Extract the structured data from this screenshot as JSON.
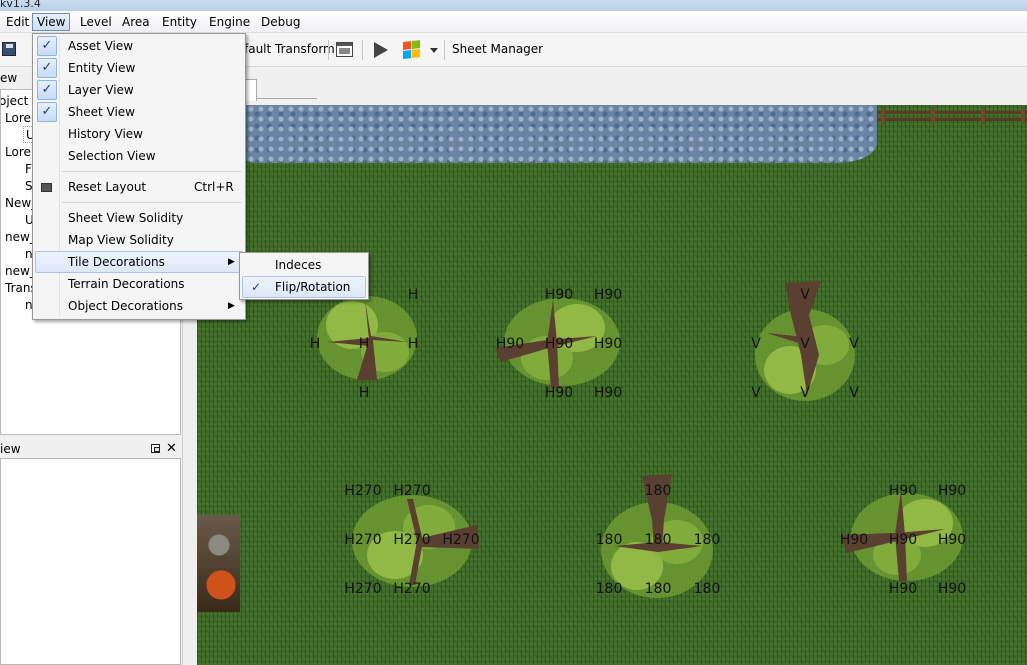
{
  "window": {
    "title": "kv1.3.4"
  },
  "menubar": [
    "Edit",
    "View",
    "Level",
    "Area",
    "Entity",
    "Engine",
    "Debug"
  ],
  "toolbar": {
    "transform_label": "fault Transform",
    "sheet_manager_label": "Sheet Manager"
  },
  "left_panel": {
    "header": "ew",
    "tree": [
      "oject",
      "Lorer",
      "U",
      "Lorer",
      "F",
      "S",
      "New_",
      "U",
      "new_",
      "n",
      "new_",
      "Trans",
      "n"
    ]
  },
  "bottom_panel": {
    "header": "iew",
    "float_icon": "float-icon",
    "close_icon": "close-icon"
  },
  "view_menu": {
    "items": [
      {
        "label": "Asset View",
        "checked": true
      },
      {
        "label": "Entity View",
        "checked": true
      },
      {
        "label": "Layer View",
        "checked": true
      },
      {
        "label": "Sheet View",
        "checked": true
      },
      {
        "label": "History View",
        "checked": false
      },
      {
        "label": "Selection View",
        "checked": false
      },
      {
        "label": "Reset Layout",
        "shortcut": "Ctrl+R"
      },
      {
        "label": "Sheet View Solidity"
      },
      {
        "label": "Map View Solidity"
      },
      {
        "label": "Tile Decorations",
        "submenu": true,
        "highlighted": true
      },
      {
        "label": "Terrain Decorations"
      },
      {
        "label": "Object Decorations",
        "submenu": true
      }
    ]
  },
  "tile_decorations_submenu": {
    "items": [
      {
        "label": "Indeces",
        "checked": false
      },
      {
        "label": "Flip/Rotation",
        "checked": true,
        "highlighted": true
      }
    ]
  },
  "map": {
    "trees": [
      {
        "labels": [
          "H",
          "H",
          "H",
          "H",
          "H"
        ]
      },
      {
        "labels": [
          "H90",
          "H90",
          "H90",
          "H90",
          "H90",
          "H90",
          "H90"
        ]
      },
      {
        "labels": [
          "V",
          "V",
          "V",
          "V",
          "V",
          "V",
          "V"
        ]
      },
      {
        "labels": [
          "H270",
          "H270",
          "H270",
          "H270",
          "H270",
          "H270",
          "H270"
        ]
      },
      {
        "labels": [
          "180",
          "180",
          "180",
          "180",
          "180",
          "180",
          "180"
        ]
      },
      {
        "labels": [
          "H90",
          "H90",
          "H90",
          "H90",
          "H90",
          "H90",
          "H90"
        ]
      }
    ]
  }
}
